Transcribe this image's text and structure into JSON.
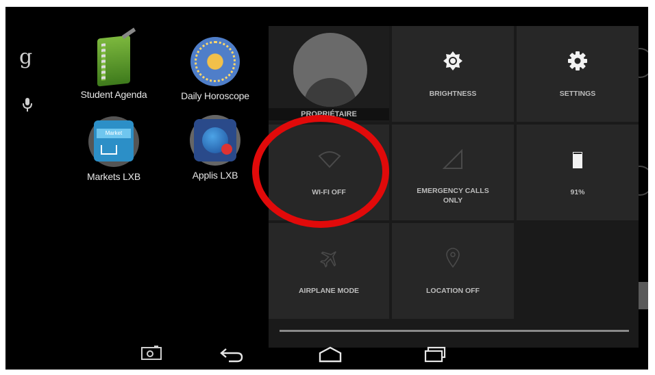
{
  "launcher": {
    "search_icon": "google-g-icon",
    "search_letter": "g",
    "voice_icon": "microphone-icon",
    "apps": [
      {
        "label": "Student Agenda",
        "icon": "notebook-icon"
      },
      {
        "label": "Daily Horoscope",
        "icon": "zodiac-icon"
      },
      {
        "label": "Markets LXB",
        "icon": "market-cart-icon"
      },
      {
        "label": "Applis LXB",
        "icon": "apps-globe-icon"
      }
    ]
  },
  "quick_settings": {
    "user": {
      "label": "PROPRIÉTAIRE",
      "icon": "user-avatar-icon"
    },
    "brightness": {
      "label": "BRIGHTNESS",
      "icon": "brightness-icon"
    },
    "settings": {
      "label": "SETTINGS",
      "icon": "gear-icon"
    },
    "wifi": {
      "label": "WI-FI OFF",
      "icon": "wifi-off-icon"
    },
    "signal": {
      "label_line1": "EMERGENCY CALLS",
      "label_line2": "ONLY",
      "icon": "signal-icon"
    },
    "battery": {
      "label": "91%",
      "icon": "battery-icon",
      "level": 0.91
    },
    "airplane": {
      "label": "AIRPLANE MODE",
      "icon": "airplane-icon"
    },
    "location": {
      "label": "LOCATION OFF",
      "icon": "location-pin-icon"
    }
  },
  "nav_bar": {
    "camera": "camera-icon",
    "back": "back-icon",
    "home": "home-icon",
    "recents": "recent-apps-icon"
  },
  "colors": {
    "highlight": "#e10a0a",
    "panel": "#1a1a1a",
    "tile": "#272727"
  }
}
